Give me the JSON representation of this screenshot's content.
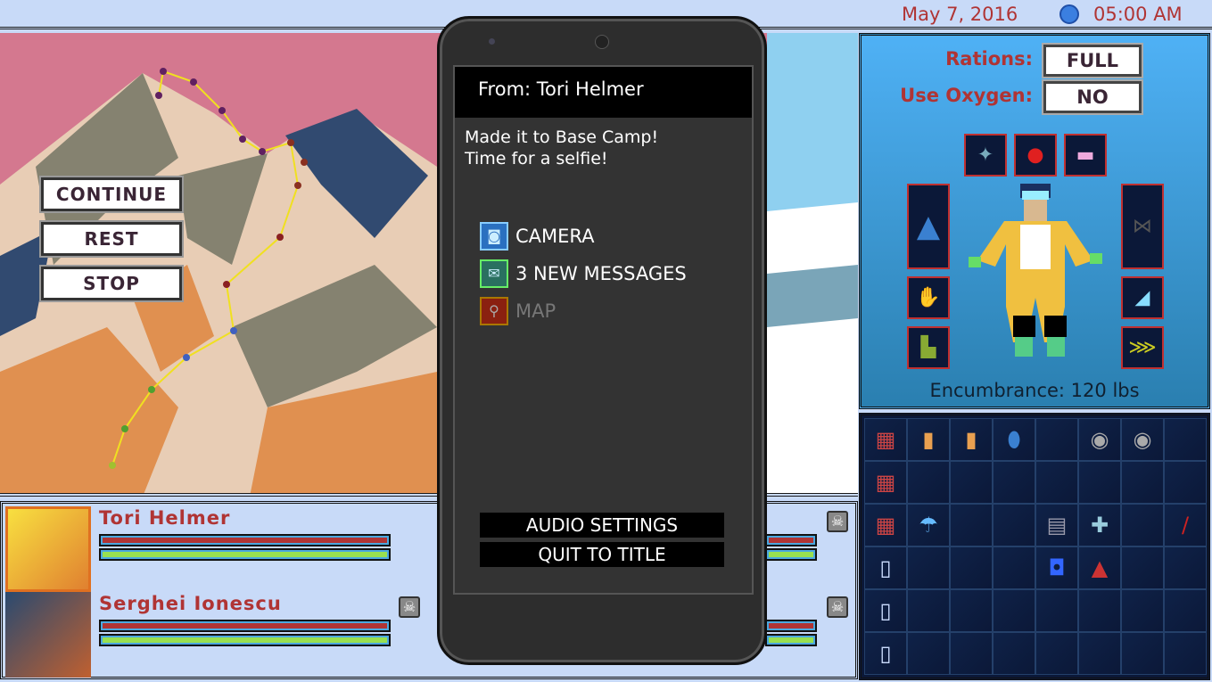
{
  "header": {
    "date": "May 7, 2016",
    "time": "05:00 AM",
    "clock_icon": "clock-icon"
  },
  "map": {
    "buttons": [
      "CONTINUE",
      "REST",
      "STOP"
    ]
  },
  "equipment": {
    "rations_label": "Rations:",
    "rations_value": "FULL",
    "oxygen_label": "Use Oxygen:",
    "oxygen_value": "NO",
    "encumbrance": "Encumbrance: 120 lbs",
    "slots": [
      "oxygen-mask",
      "helmet",
      "goggles",
      "jacket",
      "gloves",
      "boots",
      "harness",
      "ascender",
      "crampons"
    ]
  },
  "party": [
    {
      "name": "Tori Helmer",
      "health": 1.0,
      "energy": 1.0
    },
    {
      "name": "Serghei Ionescu",
      "health": 1.0,
      "energy": 1.0
    }
  ],
  "phone": {
    "from": "From: Tori Helmer",
    "message_line1": "Made it to Base Camp!",
    "message_line2": "Time for a selfie!",
    "apps": [
      {
        "label": "CAMERA",
        "icon": "camera-icon"
      },
      {
        "label": "3 NEW MESSAGES",
        "icon": "messages-icon"
      },
      {
        "label": "MAP",
        "icon": "map-pin-icon",
        "disabled": true
      }
    ],
    "audio_settings": "AUDIO SETTINGS",
    "quit": "QUIT TO TITLE"
  },
  "colors": {
    "accent_red": "#b03434",
    "health": "#b03434",
    "energy": "#98e050",
    "panel_blue": "#4fb1f5"
  }
}
